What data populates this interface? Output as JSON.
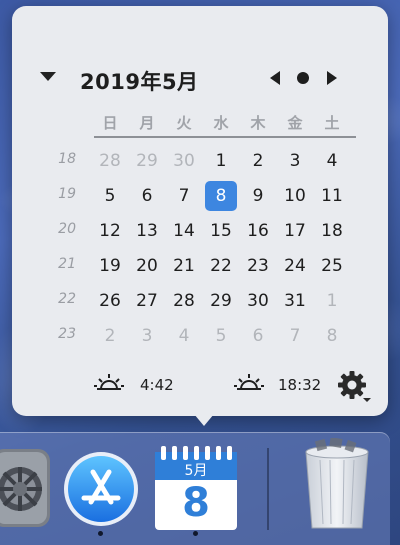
{
  "calendar": {
    "title": "2019年5月",
    "weekdays": [
      "日",
      "月",
      "火",
      "水",
      "木",
      "金",
      "土"
    ],
    "week_numbers": [
      "18",
      "19",
      "20",
      "21",
      "22",
      "23"
    ],
    "rows": [
      [
        {
          "d": "28",
          "m": true
        },
        {
          "d": "29",
          "m": true
        },
        {
          "d": "30",
          "m": true
        },
        {
          "d": "1"
        },
        {
          "d": "2"
        },
        {
          "d": "3"
        },
        {
          "d": "4"
        }
      ],
      [
        {
          "d": "5"
        },
        {
          "d": "6"
        },
        {
          "d": "7"
        },
        {
          "d": "8",
          "t": true
        },
        {
          "d": "9"
        },
        {
          "d": "10"
        },
        {
          "d": "11"
        }
      ],
      [
        {
          "d": "12"
        },
        {
          "d": "13"
        },
        {
          "d": "14"
        },
        {
          "d": "15"
        },
        {
          "d": "16"
        },
        {
          "d": "17"
        },
        {
          "d": "18"
        }
      ],
      [
        {
          "d": "19"
        },
        {
          "d": "20"
        },
        {
          "d": "21"
        },
        {
          "d": "22"
        },
        {
          "d": "23"
        },
        {
          "d": "24"
        },
        {
          "d": "25"
        }
      ],
      [
        {
          "d": "26"
        },
        {
          "d": "27"
        },
        {
          "d": "28"
        },
        {
          "d": "29"
        },
        {
          "d": "30"
        },
        {
          "d": "31"
        },
        {
          "d": "1",
          "m": true
        }
      ],
      [
        {
          "d": "2",
          "m": true
        },
        {
          "d": "3",
          "m": true
        },
        {
          "d": "4",
          "m": true
        },
        {
          "d": "5",
          "m": true
        },
        {
          "d": "6",
          "m": true
        },
        {
          "d": "7",
          "m": true
        },
        {
          "d": "8",
          "m": true
        }
      ]
    ],
    "selected_color": "#3d86e0"
  },
  "footer": {
    "sunrise": "4:42",
    "sunset": "18:32",
    "sunrise_icon": "sunrise-icon",
    "sunset_icon": "sunset-icon",
    "settings_icon": "gear-icon"
  },
  "dock": {
    "calendar_icon_month": "5月",
    "calendar_icon_day": "8",
    "apps": [
      "system-preferences-icon",
      "app-store-icon",
      "calendar-icon",
      "trash-icon"
    ]
  }
}
